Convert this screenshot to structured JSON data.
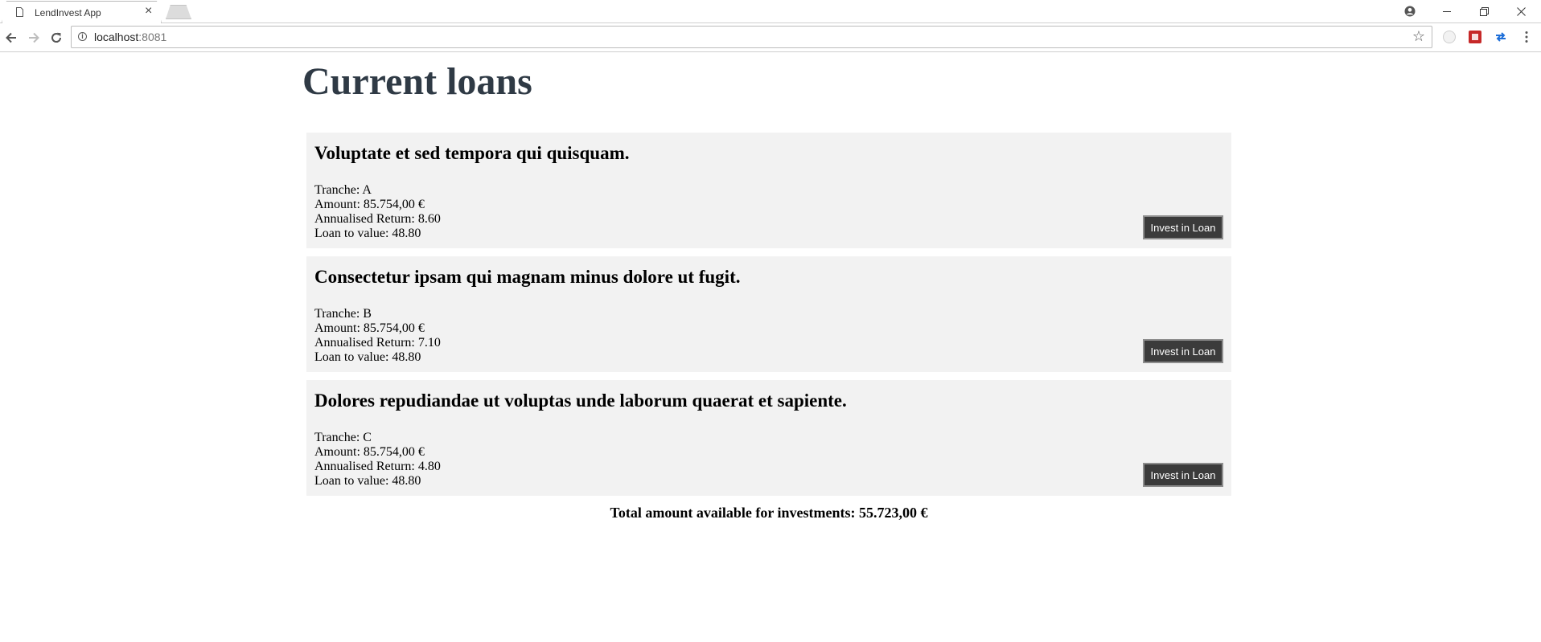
{
  "browser": {
    "tab_title": "LendInvest App",
    "tab_close": "×",
    "url_host": "localhost",
    "url_port": ":8081"
  },
  "page": {
    "title": "Current loans"
  },
  "loans": [
    {
      "title": "Voluptate et sed tempora qui quisquam.",
      "tranche": "Tranche: A",
      "amount": "Amount: 85.754,00 €",
      "annualised_return": "Annualised Return: 8.60",
      "loan_to_value": "Loan to value: 48.80",
      "button_label": "Invest in Loan"
    },
    {
      "title": "Consectetur ipsam qui magnam minus dolore ut fugit.",
      "tranche": "Tranche: B",
      "amount": "Amount: 85.754,00 €",
      "annualised_return": "Annualised Return: 7.10",
      "loan_to_value": "Loan to value: 48.80",
      "button_label": "Invest in Loan"
    },
    {
      "title": "Dolores repudiandae ut voluptas unde laborum quaerat et sapiente.",
      "tranche": "Tranche: C",
      "amount": "Amount: 85.754,00 €",
      "annualised_return": "Annualised Return: 4.80",
      "loan_to_value": "Loan to value: 48.80",
      "button_label": "Invest in Loan"
    }
  ],
  "summary": {
    "total_text": "Total amount available for investments: 55.723,00 €"
  },
  "icons": {
    "tab": "page-icon",
    "back": "arrow-left-icon",
    "forward": "arrow-right-icon",
    "reload": "reload-icon",
    "info": "info-icon",
    "bookmark": "star-icon",
    "menu": "kebab-menu-icon",
    "account": "account-icon"
  }
}
